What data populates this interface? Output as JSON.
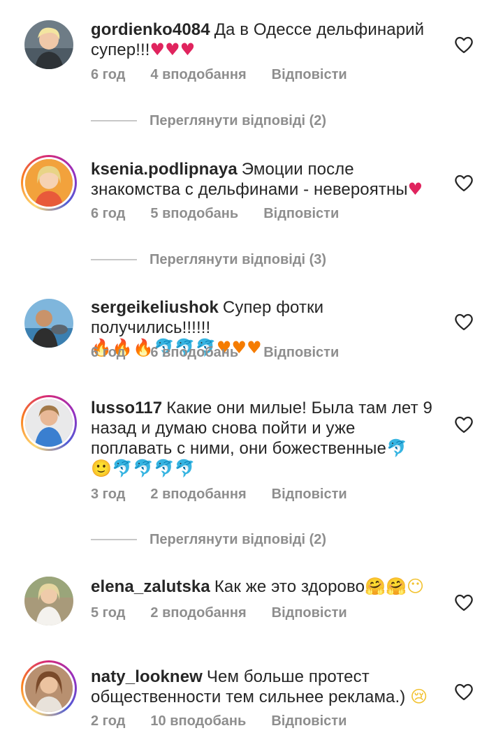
{
  "comments": [
    {
      "username": "gordienko4084",
      "text": "Да в Одессе дельфинарий супер!!!",
      "emoji": "♥♥♥",
      "time": "6 год",
      "likes": "4 вподобання",
      "reply": "Відповісти",
      "view_replies": "Переглянути відповіді (2)",
      "story_ring": false
    },
    {
      "username": "ksenia.podlipnaya",
      "text": "Эмоции после знакомства с дельфинами - невероятны",
      "emoji": "♥",
      "time": "6 год",
      "likes": "5 вподобань",
      "reply": "Відповісти",
      "view_replies": "Переглянути відповіді (3)",
      "story_ring": true
    },
    {
      "username": "sergeikeliushok",
      "text": "Супер фотки получились!!!!!!",
      "emoji": "🔥🔥🔥🐬🐬🐬♥♥♥",
      "time": "6 год",
      "likes": "6 вподобань",
      "reply": "Відповісти",
      "story_ring": false
    },
    {
      "username": "lusso117",
      "text": "Какие они милые! Была там лет 9 назад и думаю снова пойти и уже поплавать с ними, они божественные",
      "emoji": "🐬",
      "emoji_line": "🙂🐬🐬🐬🐬",
      "time": "3 год",
      "likes": "2 вподобання",
      "reply": "Відповісти",
      "view_replies": "Переглянути відповіді (2)",
      "story_ring": true
    },
    {
      "username": "elena_zalutska",
      "text": "Как же это здорово",
      "emoji": "🤗🤗😶",
      "time": "5 год",
      "likes": "2 вподобання",
      "reply": "Відповісти",
      "story_ring": false
    },
    {
      "username": "naty_looknew",
      "text": "Чем больше протест общественности тем сильнее реклама.)",
      "emoji": "😢",
      "time": "2 год",
      "likes": "10 вподобань",
      "reply": "Відповісти",
      "story_ring": true
    }
  ],
  "icons": {
    "like": "heart-outline-icon"
  },
  "colors": {
    "text": "#262626",
    "meta": "#8e8e8e",
    "heart_emoji": "#e0245e"
  }
}
